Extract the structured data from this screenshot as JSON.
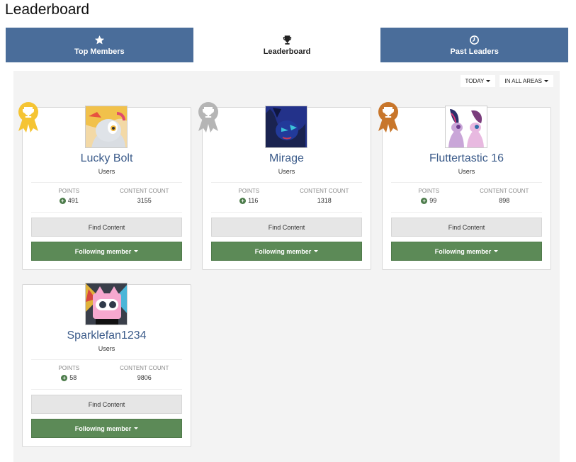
{
  "page": {
    "title": "Leaderboard"
  },
  "tabs": [
    {
      "label": "Top Members",
      "icon": "star-icon",
      "active": false
    },
    {
      "label": "Leaderboard",
      "icon": "trophy-icon",
      "active": true
    },
    {
      "label": "Past Leaders",
      "icon": "clock-icon",
      "active": false
    }
  ],
  "filters": {
    "period": "TODAY",
    "area": "IN ALL AREAS"
  },
  "colors": {
    "gold": "#f5c433",
    "silver": "#b5b5b5",
    "bronze": "#c8762b",
    "tab_bg": "#4a6d9a",
    "follow_bg": "#5c8a57",
    "name": "#3b5b8a"
  },
  "stat_labels": {
    "points": "POINTS",
    "content_count": "CONTENT COUNT"
  },
  "buttons": {
    "find_content": "Find Content",
    "following": "Following member"
  },
  "members": [
    {
      "rank": 1,
      "medal": "gold-ribbon-icon",
      "name": "Lucky Bolt",
      "group": "Users",
      "points": "491",
      "content_count": "3155"
    },
    {
      "rank": 2,
      "medal": "silver-ribbon-icon",
      "name": "Mirage",
      "group": "Users",
      "points": "116",
      "content_count": "1318"
    },
    {
      "rank": 3,
      "medal": "bronze-ribbon-icon",
      "name": "Fluttertastic 16",
      "group": "Users",
      "points": "99",
      "content_count": "898"
    },
    {
      "rank": 4,
      "medal": null,
      "name": "Sparklefan1234",
      "group": "Users",
      "points": "58",
      "content_count": "9806"
    }
  ]
}
